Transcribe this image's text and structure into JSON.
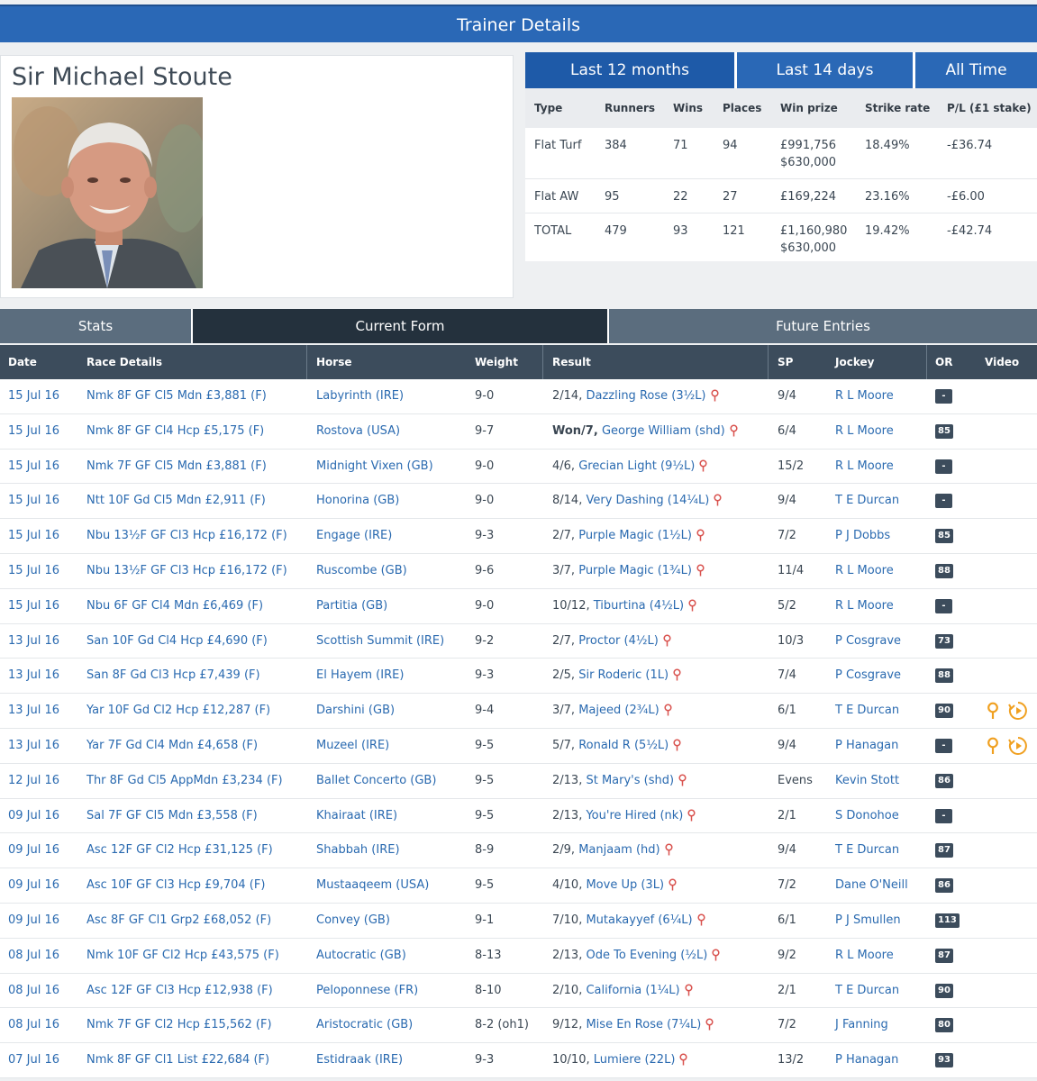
{
  "header": {
    "title": "Trainer Details"
  },
  "trainer": {
    "name": "Sir Michael Stoute"
  },
  "period_tabs": [
    "Last 12 months",
    "Last 14 days",
    "All Time"
  ],
  "stats": {
    "columns": [
      "Type",
      "Runners",
      "Wins",
      "Places",
      "Win prize",
      "Strike rate",
      "P/L (£1 stake)"
    ],
    "rows": [
      {
        "type": "Flat Turf",
        "runners": "384",
        "wins": "71",
        "places": "94",
        "prize1": "£991,756",
        "prize2": "$630,000",
        "strike": "18.49%",
        "pl": "-£36.74"
      },
      {
        "type": "Flat AW",
        "runners": "95",
        "wins": "22",
        "places": "27",
        "prize1": "£169,224",
        "prize2": "",
        "strike": "23.16%",
        "pl": "-£6.00"
      },
      {
        "type": "TOTAL",
        "runners": "479",
        "wins": "93",
        "places": "121",
        "prize1": "£1,160,980",
        "prize2": "$630,000",
        "strike": "19.42%",
        "pl": "-£42.74"
      }
    ]
  },
  "main_tabs": [
    "Stats",
    "Current Form",
    "Future Entries"
  ],
  "form": {
    "columns": [
      "Date",
      "Race Details",
      "Horse",
      "Weight",
      "Result",
      "SP",
      "Jockey",
      "OR",
      "Video"
    ],
    "rows": [
      {
        "date": "15 Jul 16",
        "race": "Nmk 8F GF Cl5 Mdn £3,881 (F)",
        "horse": "Labyrinth (IRE)",
        "weight": "9-0",
        "pos": "2/14,",
        "winner": "Dazzling Rose (3½L)",
        "sp": "9/4",
        "jockey": "R L Moore",
        "or": "-"
      },
      {
        "date": "15 Jul 16",
        "race": "Nmk 8F GF Cl4 Hcp £5,175 (F)",
        "horse": "Rostova (USA)",
        "weight": "9-7",
        "pos": "Won/7,",
        "winner": "George William (shd)",
        "sp": "6/4",
        "jockey": "R L Moore",
        "or": "85"
      },
      {
        "date": "15 Jul 16",
        "race": "Nmk 7F GF Cl5 Mdn £3,881 (F)",
        "horse": "Midnight Vixen (GB)",
        "weight": "9-0",
        "pos": "4/6,",
        "winner": "Grecian Light (9½L)",
        "sp": "15/2",
        "jockey": "R L Moore",
        "or": "-"
      },
      {
        "date": "15 Jul 16",
        "race": "Ntt 10F Gd Cl5 Mdn £2,911 (F)",
        "horse": "Honorina (GB)",
        "weight": "9-0",
        "pos": "8/14,",
        "winner": "Very Dashing (14¼L)",
        "sp": "9/4",
        "jockey": "T E Durcan",
        "or": "-"
      },
      {
        "date": "15 Jul 16",
        "race": "Nbu 13½F GF Cl3 Hcp £16,172 (F)",
        "horse": "Engage (IRE)",
        "weight": "9-3",
        "pos": "2/7,",
        "winner": "Purple Magic (1½L)",
        "sp": "7/2",
        "jockey": "P J Dobbs",
        "or": "85"
      },
      {
        "date": "15 Jul 16",
        "race": "Nbu 13½F GF Cl3 Hcp £16,172 (F)",
        "horse": "Ruscombe (GB)",
        "weight": "9-6",
        "pos": "3/7,",
        "winner": "Purple Magic (1¾L)",
        "sp": "11/4",
        "jockey": "R L Moore",
        "or": "88"
      },
      {
        "date": "15 Jul 16",
        "race": "Nbu 6F GF Cl4 Mdn £6,469 (F)",
        "horse": "Partitia (GB)",
        "weight": "9-0",
        "pos": "10/12,",
        "winner": "Tiburtina (4½L)",
        "sp": "5/2",
        "jockey": "R L Moore",
        "or": "-"
      },
      {
        "date": "13 Jul 16",
        "race": "San 10F Gd Cl4 Hcp £4,690 (F)",
        "horse": "Scottish Summit (IRE)",
        "weight": "9-2",
        "pos": "2/7,",
        "winner": "Proctor (4½L)",
        "sp": "10/3",
        "jockey": "P Cosgrave",
        "or": "73"
      },
      {
        "date": "13 Jul 16",
        "race": "San 8F Gd Cl3 Hcp £7,439 (F)",
        "horse": "El Hayem (IRE)",
        "weight": "9-3",
        "pos": "2/5,",
        "winner": "Sir Roderic (1L)",
        "sp": "7/4",
        "jockey": "P Cosgrave",
        "or": "88"
      },
      {
        "date": "13 Jul 16",
        "race": "Yar 10F Gd Cl2 Hcp £12,287 (F)",
        "horse": "Darshini (GB)",
        "weight": "9-4",
        "pos": "3/7,",
        "winner": "Majeed (2¾L)",
        "sp": "6/1",
        "jockey": "T E Durcan",
        "or": "90",
        "video": true
      },
      {
        "date": "13 Jul 16",
        "race": "Yar 7F Gd Cl4 Mdn £4,658 (F)",
        "horse": "Muzeel (IRE)",
        "weight": "9-5",
        "pos": "5/7,",
        "winner": "Ronald R (5½L)",
        "sp": "9/4",
        "jockey": "P Hanagan",
        "or": "-",
        "video": true
      },
      {
        "date": "12 Jul 16",
        "race": "Thr 8F Gd Cl5 AppMdn £3,234 (F)",
        "horse": "Ballet Concerto (GB)",
        "weight": "9-5",
        "pos": "2/13,",
        "winner": "St Mary's (shd)",
        "sp": "Evens",
        "jockey": "Kevin Stott",
        "or": "86"
      },
      {
        "date": "09 Jul 16",
        "race": "Sal 7F GF Cl5 Mdn £3,558 (F)",
        "horse": "Khairaat (IRE)",
        "weight": "9-5",
        "pos": "2/13,",
        "winner": "You're Hired (nk)",
        "sp": "2/1",
        "jockey": "S Donohoe",
        "or": "-"
      },
      {
        "date": "09 Jul 16",
        "race": "Asc 12F GF Cl2 Hcp £31,125 (F)",
        "horse": "Shabbah (IRE)",
        "weight": "8-9",
        "pos": "2/9,",
        "winner": "Manjaam (hd)",
        "sp": "9/4",
        "jockey": "T E Durcan",
        "or": "87"
      },
      {
        "date": "09 Jul 16",
        "race": "Asc 10F GF Cl3 Hcp £9,704 (F)",
        "horse": "Mustaaqeem (USA)",
        "weight": "9-5",
        "pos": "4/10,",
        "winner": "Move Up (3L)",
        "sp": "7/2",
        "jockey": "Dane O'Neill",
        "or": "86"
      },
      {
        "date": "09 Jul 16",
        "race": "Asc 8F GF Cl1 Grp2 £68,052 (F)",
        "horse": "Convey (GB)",
        "weight": "9-1",
        "pos": "7/10,",
        "winner": "Mutakayyef (6¼L)",
        "sp": "6/1",
        "jockey": "P J Smullen",
        "or": "113"
      },
      {
        "date": "08 Jul 16",
        "race": "Nmk 10F GF Cl2 Hcp £43,575 (F)",
        "horse": "Autocratic (GB)",
        "weight": "8-13",
        "pos": "2/13,",
        "winner": "Ode To Evening (½L)",
        "sp": "9/2",
        "jockey": "R L Moore",
        "or": "87"
      },
      {
        "date": "08 Jul 16",
        "race": "Asc 12F GF Cl3 Hcp £12,938 (F)",
        "horse": "Peloponnese (FR)",
        "weight": "8-10",
        "pos": "2/10,",
        "winner": "California (1¼L)",
        "sp": "2/1",
        "jockey": "T E Durcan",
        "or": "90"
      },
      {
        "date": "08 Jul 16",
        "race": "Nmk 7F GF Cl2 Hcp £15,562 (F)",
        "horse": "Aristocratic (GB)",
        "weight": "8-2 (oh1)",
        "pos": "9/12,",
        "winner": "Mise En Rose (7¼L)",
        "sp": "7/2",
        "jockey": "J Fanning",
        "or": "80"
      },
      {
        "date": "07 Jul 16",
        "race": "Nmk 8F GF Cl1 List £22,684 (F)",
        "horse": "Estidraak (IRE)",
        "weight": "9-3",
        "pos": "10/10,",
        "winner": "Lumiere (22L)",
        "sp": "13/2",
        "jockey": "P Hanagan",
        "or": "93"
      }
    ]
  },
  "colors": {
    "brand_blue": "#2a68b6",
    "table_head": "#3c4c5c",
    "link": "#2a6ab0",
    "accent_orange": "#f0a020"
  },
  "icons": {
    "result_pin": "pin-icon",
    "video_pin": "location-pin-icon",
    "video_play": "play-icon"
  }
}
